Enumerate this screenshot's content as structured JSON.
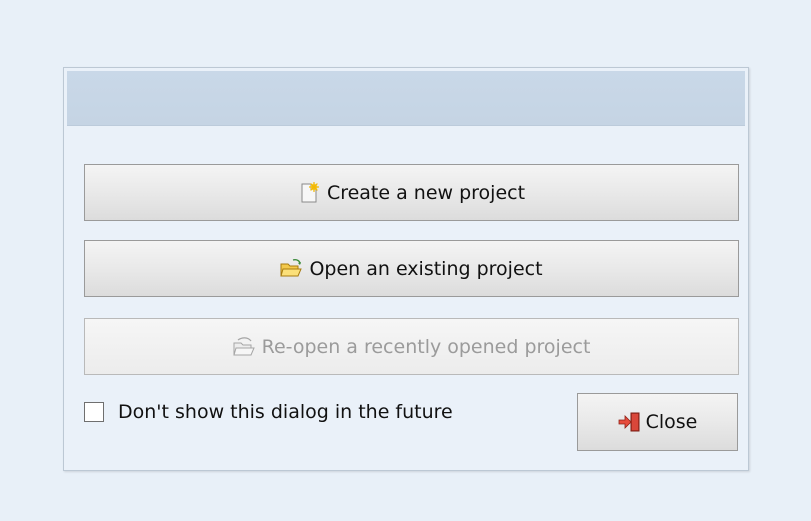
{
  "dialog": {
    "buttons": {
      "create_label": "Create a new project",
      "open_label": "Open an existing project",
      "reopen_label": "Re-open a recently opened project",
      "close_label": "Close"
    },
    "checkbox": {
      "label": "Don't show this dialog in the future",
      "checked": false
    },
    "icons": {
      "create": "new-project-icon",
      "open": "folder-open-icon",
      "reopen": "folder-reopen-icon",
      "close": "exit-door-icon"
    },
    "colors": {
      "background": "#e8f0f8",
      "titlebar": "#c7d6e6",
      "disabled_text": "#9b9b9b"
    }
  }
}
